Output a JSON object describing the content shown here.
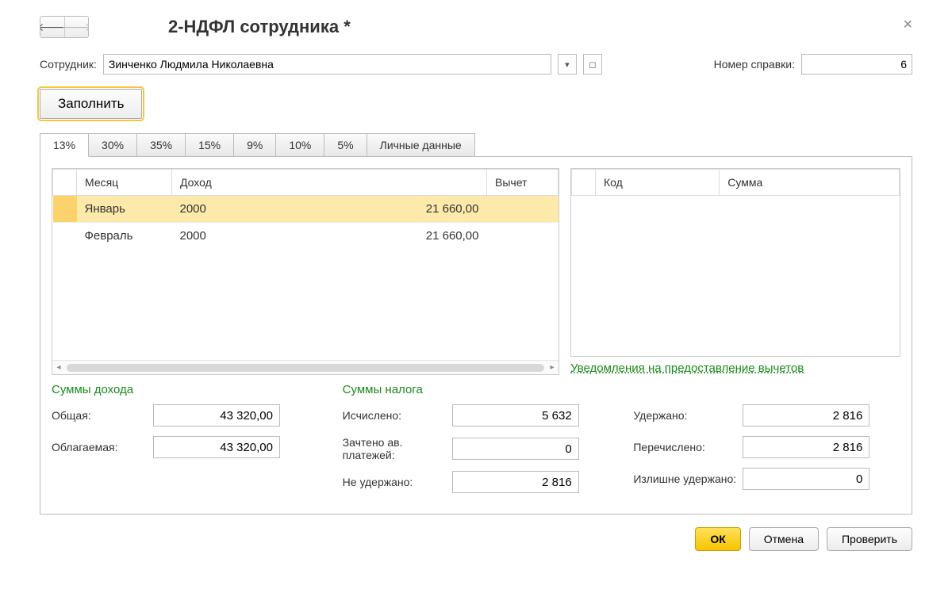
{
  "header": {
    "title": "2-НДФЛ сотрудника *"
  },
  "employee": {
    "label": "Сотрудник:",
    "value": "Зинченко Людмила Николаевна"
  },
  "certificate": {
    "label": "Номер справки:",
    "value": "6"
  },
  "fill_button": "Заполнить",
  "tabs": [
    "13%",
    "30%",
    "35%",
    "15%",
    "9%",
    "10%",
    "5%",
    "Личные данные"
  ],
  "income_table": {
    "headers": {
      "month": "Месяц",
      "income": "Доход",
      "deduction": "Вычет"
    },
    "rows": [
      {
        "month": "Январь",
        "code": "2000",
        "amount": "21 660,00"
      },
      {
        "month": "Февраль",
        "code": "2000",
        "amount": "21 660,00"
      }
    ]
  },
  "deduction_table": {
    "headers": {
      "code": "Код",
      "sum": "Сумма"
    }
  },
  "deductions_link": "Уведомления на предоставление вычетов",
  "income_sums": {
    "title": "Суммы дохода",
    "total_label": "Общая:",
    "total_value": "43 320,00",
    "taxable_label": "Облагаемая:",
    "taxable_value": "43 320,00"
  },
  "tax_sums": {
    "title": "Суммы налога",
    "calculated_label": "Исчислено:",
    "calculated_value": "5 632",
    "advance_label": "Зачтено ав. платежей:",
    "advance_value": "0",
    "not_withheld_label": "Не удержано:",
    "not_withheld_value": "2 816",
    "withheld_label": "Удержано:",
    "withheld_value": "2 816",
    "transferred_label": "Перечислено:",
    "transferred_value": "2 816",
    "excess_label": "Излишне удержано:",
    "excess_value": "0"
  },
  "footer": {
    "ok": "ОК",
    "cancel": "Отмена",
    "check": "Проверить"
  }
}
